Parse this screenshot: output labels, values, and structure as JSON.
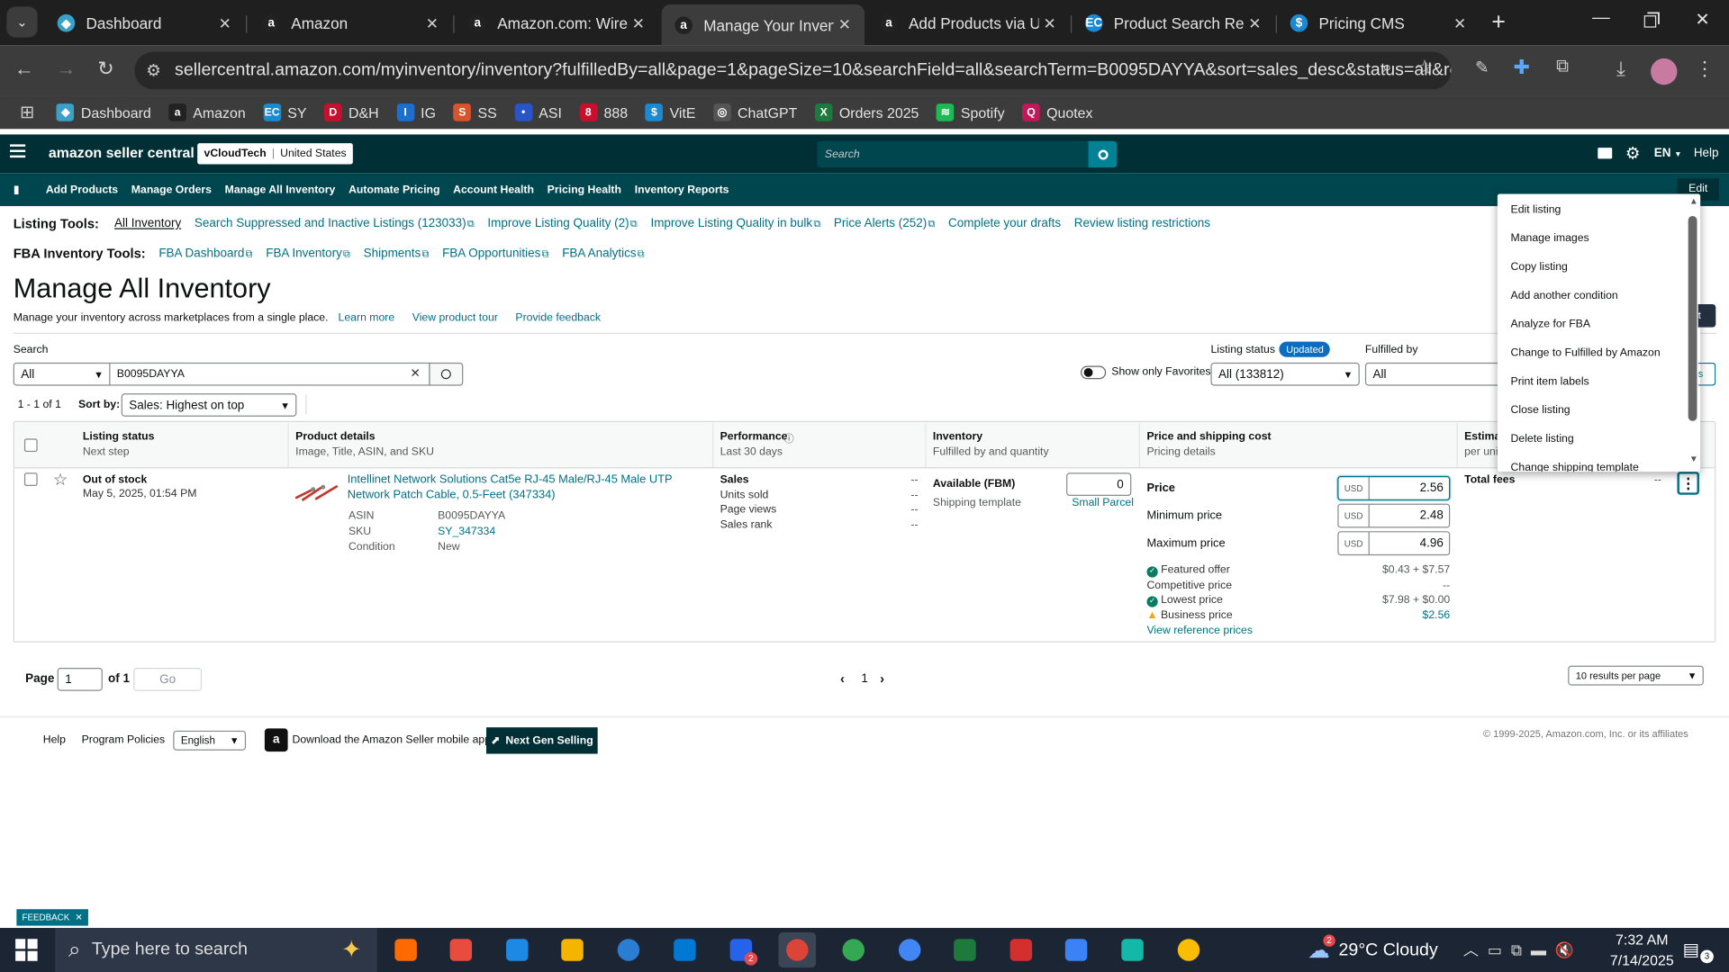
{
  "browser": {
    "tabs": [
      {
        "title": "Dashboard",
        "color": "#3aa0c8",
        "glyph": "◆"
      },
      {
        "title": "Amazon",
        "color": "#222",
        "glyph": "a"
      },
      {
        "title": "Amazon.com: Wirele",
        "color": "#222",
        "glyph": "a"
      },
      {
        "title": "Manage Your Invento",
        "color": "#222",
        "glyph": "a"
      },
      {
        "title": "Add Products via Upl",
        "color": "#222",
        "glyph": "a"
      },
      {
        "title": "Product Search Resul",
        "color": "#1a8ad4",
        "glyph": "EC"
      },
      {
        "title": "Pricing CMS",
        "color": "#1a8ad4",
        "glyph": "$"
      }
    ],
    "close_glyph": "✕",
    "new_tab_glyph": "+",
    "url": "sellercentral.amazon.com/myinventory/inventory?fulfilledBy=all&page=1&pageSize=10&searchField=all&searchTerm=B0095DAYYA&sort=sales_desc&status=all&ref_=x...",
    "bookmarks": [
      {
        "label": "Dashboard",
        "color": "#3aa0c8",
        "glyph": "◆"
      },
      {
        "label": "Amazon",
        "color": "#222",
        "glyph": "a"
      },
      {
        "label": "SY",
        "color": "#1a8ad4",
        "glyph": "EC"
      },
      {
        "label": "D&H",
        "color": "#c8102e",
        "glyph": "D"
      },
      {
        "label": "IG",
        "color": "#1a6fd0",
        "glyph": "I"
      },
      {
        "label": "SS",
        "color": "#d9532c",
        "glyph": "S"
      },
      {
        "label": "ASI",
        "color": "#2a55c8",
        "glyph": "•"
      },
      {
        "label": "888",
        "color": "#c8102e",
        "glyph": "8"
      },
      {
        "label": "VitE",
        "color": "#1a8ad4",
        "glyph": "$"
      },
      {
        "label": "ChatGPT",
        "color": "#555",
        "glyph": "◎"
      },
      {
        "label": "Orders 2025",
        "color": "#1e7a3c",
        "glyph": "X"
      },
      {
        "label": "Spotify",
        "color": "#1db954",
        "glyph": "≋"
      },
      {
        "label": "Quotex",
        "color": "#c2185b",
        "glyph": "Q"
      }
    ]
  },
  "sc": {
    "logo": "amazon seller central",
    "account": "vCloudTech",
    "marketplace": "United States",
    "search_placeholder": "Search",
    "lang": "EN",
    "help": "Help",
    "nav": [
      "Add Products",
      "Manage Orders",
      "Manage All Inventory",
      "Automate Pricing",
      "Account Health",
      "Pricing Health",
      "Inventory Reports"
    ],
    "edit": "Edit"
  },
  "tools": {
    "listing_label": "Listing Tools:",
    "listing": [
      "All Inventory",
      "Search Suppressed and Inactive Listings (123033)",
      "Improve Listing Quality (2)",
      "Improve Listing Quality in bulk",
      "Price Alerts (252)",
      "Complete your drafts",
      "Review listing restrictions"
    ],
    "fba_label": "FBA Inventory Tools:",
    "fba": [
      "FBA Dashboard",
      "FBA Inventory",
      "Shipments",
      "FBA Opportunities",
      "FBA Analytics"
    ]
  },
  "page": {
    "title": "Manage All Inventory",
    "subtitle": "Manage your inventory across marketplaces from a single place.",
    "learn_more": "Learn more",
    "product_tour": "View product tour",
    "feedback": "Provide feedback"
  },
  "filters": {
    "search_label": "Search",
    "field": "All",
    "term": "B0095DAYYA",
    "favorites": "Show only Favorites",
    "status_label": "Listing status",
    "updated_badge": "Updated",
    "status_value": "All (133812)",
    "fulfilled_label": "Fulfilled by",
    "fulfilled_value": "All",
    "count": "1 - 1 of 1",
    "sortby_label": "Sort by:",
    "sortby_value": "Sales: Highest on top"
  },
  "table": {
    "headers": [
      {
        "t": "Listing status",
        "s": "Next step"
      },
      {
        "t": "Product details",
        "s": "Image, Title, ASIN, and SKU"
      },
      {
        "t": "Performance",
        "s": "Last 30 days"
      },
      {
        "t": "Inventory",
        "s": "Fulfilled by and quantity"
      },
      {
        "t": "Price and shipping cost",
        "s": "Pricing details"
      },
      {
        "t": "Estima",
        "s": "per uni"
      }
    ],
    "row": {
      "status": "Out of stock",
      "date": "May 5, 2025, 01:54 PM",
      "title": "Intellinet Network Solutions Cat5e RJ-45 Male/RJ-45 Male UTP Network Patch Cable, 0.5-Feet (347334)",
      "asin_label": "ASIN",
      "asin": "B0095DAYYA",
      "sku_label": "SKU",
      "sku": "SY_347334",
      "cond_label": "Condition",
      "cond": "New",
      "perf": [
        {
          "l": "Sales",
          "v": "--"
        },
        {
          "l": "Units sold",
          "v": "--"
        },
        {
          "l": "Page views",
          "v": "--"
        },
        {
          "l": "Sales rank",
          "v": "--"
        }
      ],
      "inv_label": "Available (FBM)",
      "qty": "0",
      "ship_label": "Shipping template",
      "ship_value": "Small Parcel",
      "price_label": "Price",
      "price": "2.56",
      "min_label": "Minimum price",
      "min": "2.48",
      "max_label": "Maximum price",
      "max": "4.96",
      "currency": "USD",
      "featured_label": "Featured offer",
      "featured": "$0.43 + $7.57",
      "competitive_label": "Competitive price",
      "competitive": "--",
      "lowest_label": "Lowest price",
      "lowest": "$7.98 + $0.00",
      "business_label": "Business price",
      "business": "$2.56",
      "ref_link": "View reference prices",
      "fees_label": "Total fees",
      "fees": "--"
    }
  },
  "pager": {
    "page_label": "Page",
    "page": "1",
    "of": "of 1",
    "go": "Go",
    "current": "1",
    "per_page": "10 results per page"
  },
  "footer": {
    "help": "Help",
    "policies": "Program Policies",
    "lang": "English",
    "app": "Download the Amazon Seller mobile app",
    "next_gen": "Next Gen Selling",
    "copyright": "© 1999-2025, Amazon.com, Inc. or its affiliates"
  },
  "menu": [
    "Edit listing",
    "Manage images",
    "Copy listing",
    "Add another condition",
    "Analyze for FBA",
    "Change to Fulfilled by Amazon",
    "Print item labels",
    "Close listing",
    "Delete listing",
    "Change shipping template"
  ],
  "feedback_tab": "FEEDBACK",
  "taskbar": {
    "search": "Type here to search",
    "weather": "29°C  Cloudy",
    "time": "7:32 AM",
    "date": "7/14/2025",
    "chrome_badge": "2",
    "weather_badge": "2"
  }
}
